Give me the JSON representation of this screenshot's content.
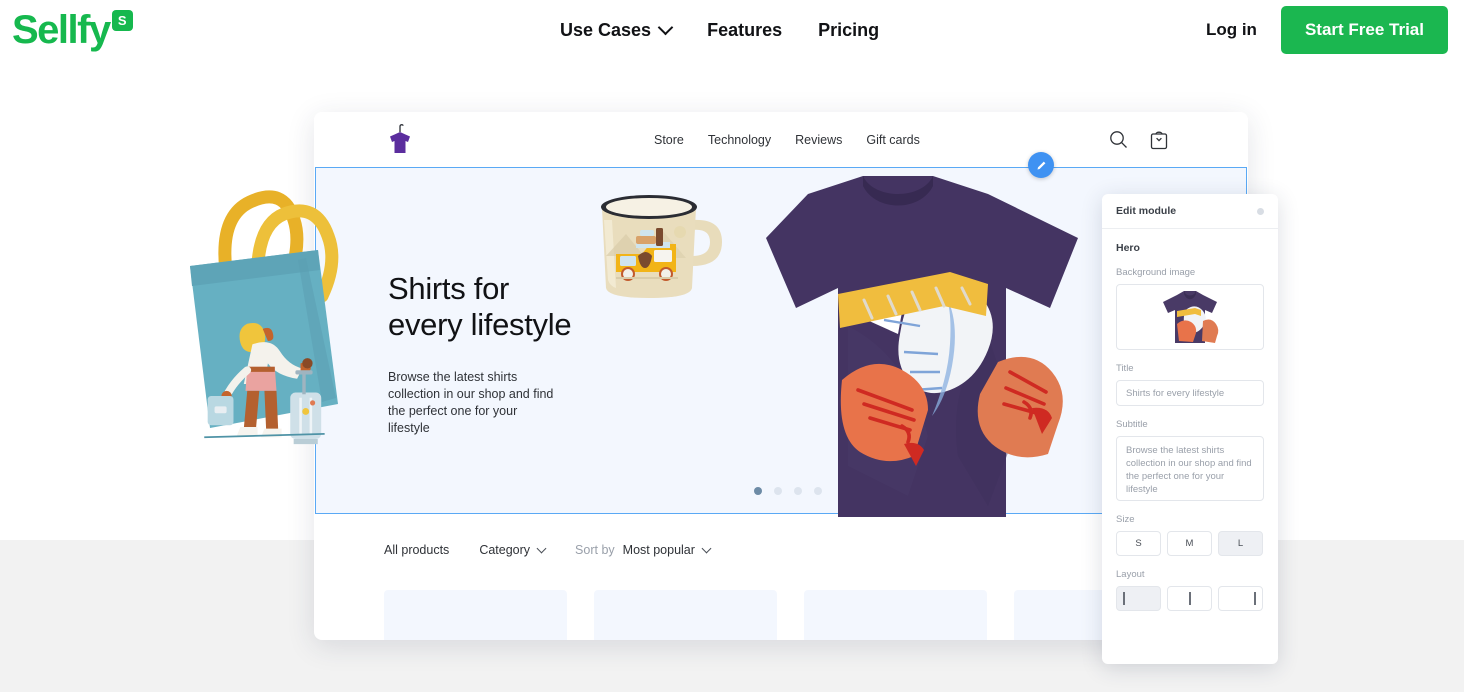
{
  "brand": {
    "name": "Sellfy",
    "badge": "S",
    "green": "#16b84e"
  },
  "header": {
    "nav": [
      {
        "label": "Use Cases",
        "has_chevron": true
      },
      {
        "label": "Features",
        "has_chevron": false
      },
      {
        "label": "Pricing",
        "has_chevron": false
      }
    ],
    "login_label": "Log in",
    "cta_label": "Start Free Trial",
    "cta_color": "#1bb750"
  },
  "store_mockup": {
    "logo_icon": "tshirt-hanger-icon",
    "nav": [
      {
        "label": "Store"
      },
      {
        "label": "Technology"
      },
      {
        "label": "Reviews"
      },
      {
        "label": "Gift cards"
      }
    ],
    "icons": [
      {
        "name": "search-icon"
      },
      {
        "name": "shopping-bag-icon"
      }
    ],
    "hero": {
      "title": "Shirts for\never y lifestyle",
      "title_line1": "Shirts for",
      "title_line2": "every lifestyle",
      "subtitle": "Browse the latest shirts collection in our shop and find the perfect one for your lifestyle",
      "carousel_dots": 4,
      "active_dot": 0,
      "selection_color": "#5aa9f5",
      "background": "#f3f7fe",
      "edit_badge_icon": "pencil-icon"
    },
    "filters": {
      "all_products": "All products",
      "category": "Category",
      "sort_by_label": "Sort by",
      "sort_value": "Most popular"
    },
    "product_cards": 4
  },
  "panel": {
    "title": "Edit module",
    "handle_icon": "drag-dot-icon",
    "section": "Hero",
    "background_image_label": "Background image",
    "background_image_alt": "purple-tshirt-thumbnail",
    "title_label": "Title",
    "title_value": "Shirts for every lifestyle",
    "subtitle_label": "Subtitle",
    "subtitle_value": "Browse the latest shirts collection in our shop and find the perfect one for your lifestyle",
    "size_label": "Size",
    "size_options": [
      {
        "label": "S",
        "selected": false
      },
      {
        "label": "M",
        "selected": false
      },
      {
        "label": "L",
        "selected": true
      }
    ],
    "layout_label": "Layout",
    "layout_options": [
      {
        "name": "layout-left",
        "selected": true
      },
      {
        "name": "layout-center",
        "selected": false
      },
      {
        "name": "layout-right",
        "selected": false
      }
    ]
  }
}
